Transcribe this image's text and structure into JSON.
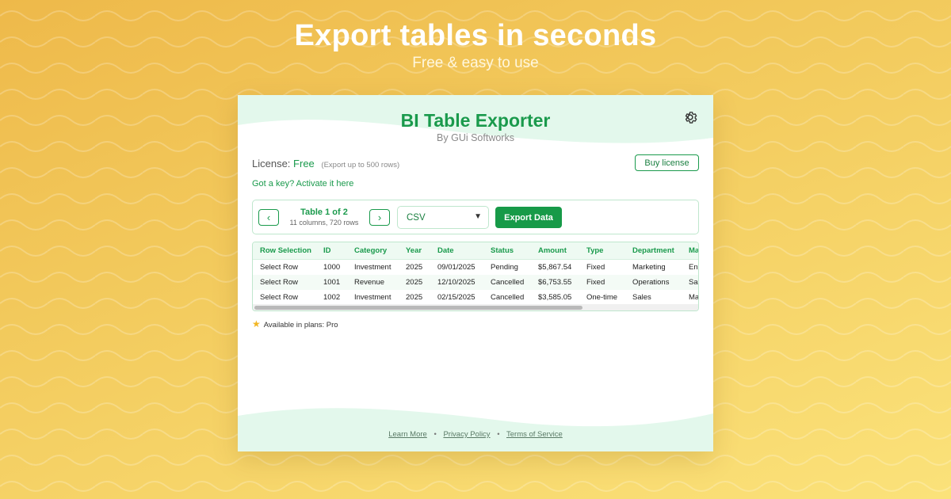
{
  "hero": {
    "title": "Export tables in seconds",
    "subtitle": "Free & easy to use"
  },
  "app": {
    "title": "BI Table Exporter",
    "byline": "By GUi Softworks",
    "settings_icon": "gear-icon"
  },
  "license": {
    "label": "License:",
    "value": "Free",
    "note": "(Export up to 500 rows)",
    "buy_label": "Buy license",
    "activate_link": "Got a key? Activate it here"
  },
  "controls": {
    "prev_icon": "chevron-left-icon",
    "next_icon": "chevron-right-icon",
    "table_name": "Table 1 of 2",
    "table_meta": "11 columns, 720 rows",
    "format_selected": "CSV",
    "export_label": "Export Data"
  },
  "grid": {
    "columns": [
      "Row Selection",
      "ID",
      "Category",
      "Year",
      "Date",
      "Status",
      "Amount",
      "Type",
      "Department",
      "Ma"
    ],
    "rows": [
      [
        "Select Row",
        "1000",
        "Investment",
        "2025",
        "09/01/2025",
        "Pending",
        "$5,867.54",
        "Fixed",
        "Marketing",
        "En"
      ],
      [
        "Select Row",
        "1001",
        "Revenue",
        "2025",
        "12/10/2025",
        "Cancelled",
        "$6,753.55",
        "Fixed",
        "Operations",
        "Sa"
      ],
      [
        "Select Row",
        "1002",
        "Investment",
        "2025",
        "02/15/2025",
        "Cancelled",
        "$3,585.05",
        "One-time",
        "Sales",
        "Ma"
      ]
    ]
  },
  "plans": {
    "icon": "star-icon",
    "text": "Available in plans: Pro"
  },
  "footer": {
    "learn_more": "Learn More",
    "privacy": "Privacy Policy",
    "terms": "Terms of Service",
    "separator": "•"
  },
  "colors": {
    "accent": "#1a9a4c",
    "background_top": "#eeb94a",
    "background_bottom": "#fbe27a",
    "panel_mint": "#e3f8ec"
  }
}
